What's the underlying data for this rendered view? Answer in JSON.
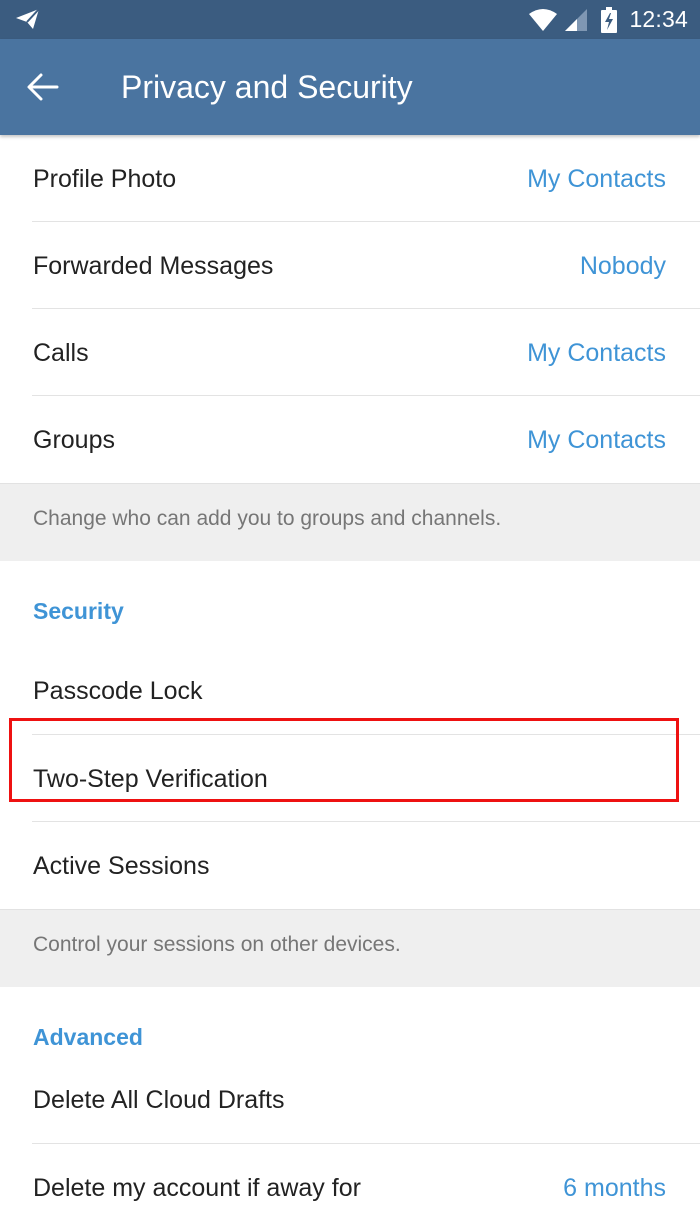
{
  "status_bar": {
    "app_icon": "telegram-icon",
    "wifi_icon": "wifi-icon",
    "signal_icon": "cell-signal-icon",
    "battery_icon": "battery-charging-icon",
    "time": "12:34"
  },
  "app_bar": {
    "back_icon": "arrow-left-icon",
    "title": "Privacy and Security"
  },
  "privacy_rows": [
    {
      "label": "Profile Photo",
      "value": "My Contacts"
    },
    {
      "label": "Forwarded Messages",
      "value": "Nobody"
    },
    {
      "label": "Calls",
      "value": "My Contacts"
    },
    {
      "label": "Groups",
      "value": "My Contacts"
    }
  ],
  "privacy_hint": "Change who can add you to groups and channels.",
  "security": {
    "header": "Security",
    "rows": [
      {
        "label": "Passcode Lock"
      },
      {
        "label": "Two-Step Verification",
        "highlighted": true
      },
      {
        "label": "Active Sessions"
      }
    ],
    "hint": "Control your sessions on other devices."
  },
  "advanced": {
    "header": "Advanced",
    "rows": [
      {
        "label": "Delete All Cloud Drafts"
      },
      {
        "label": "Delete my account if away for",
        "value": "6 months"
      }
    ]
  },
  "colors": {
    "status_bar": "#3b5c80",
    "app_bar": "#4a74a0",
    "accent": "#3f94d6",
    "highlight_box": "#ee1111"
  }
}
